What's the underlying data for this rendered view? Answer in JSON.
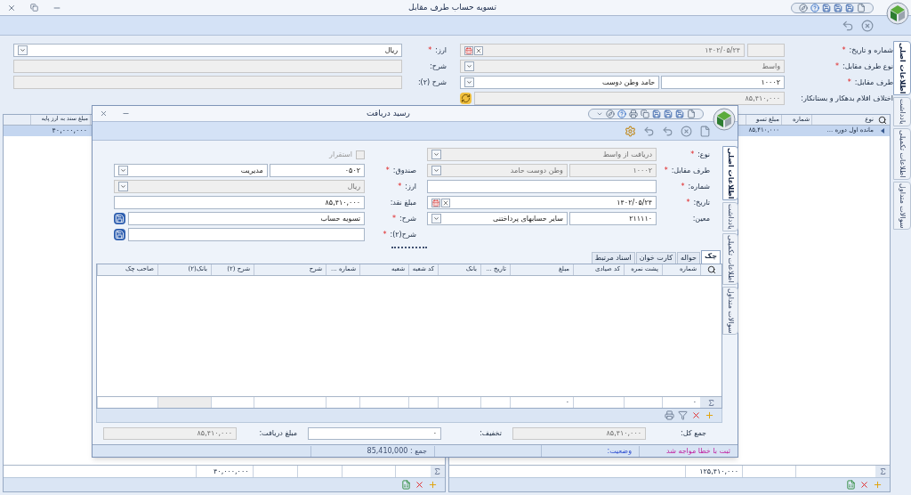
{
  "window": {
    "title": "تسویه حساب طرف مقابل"
  },
  "side_tabs": [
    {
      "label": "اطلاعات اصلی",
      "selected": true
    },
    {
      "label": "یادداشت",
      "selected": false
    },
    {
      "label": "اطلاعات تکمیلی",
      "selected": false
    },
    {
      "label": "سوالات متداول",
      "selected": false
    }
  ],
  "form": {
    "right": [
      {
        "kind": "number_date",
        "label": "شماره و تاریخ:",
        "required_mark": "*",
        "disabled": true,
        "value": "۱۴۰۲/۰۵/۲۴"
      },
      {
        "kind": "select",
        "label": "نوع طرف مقابل:",
        "required_mark": "*",
        "disabled": true,
        "value": "واسط"
      },
      {
        "kind": "code_select",
        "label": "طرف مقابل:",
        "required_mark": "*",
        "disabled": false,
        "code": "۱۰۰۰۲",
        "value": "حامد وطن دوست"
      },
      {
        "kind": "amount",
        "label": "اختلاف اقلام بدهکار و بستانکار:",
        "disabled": true,
        "value": "۸۵,۴۱۰,۰۰۰"
      }
    ],
    "left": [
      {
        "kind": "select",
        "label": "ارز:",
        "required_mark": "*",
        "disabled": false,
        "value": "ریال"
      },
      {
        "kind": "text",
        "label": "شرح:",
        "disabled": true
      },
      {
        "kind": "text",
        "label": "شرح (۲):",
        "disabled": true
      }
    ]
  },
  "grids": {
    "left": {
      "columns": [
        {
          "label": "مبلغ سند به ارز پایه"
        }
      ],
      "rows": [
        {
          "selected": true,
          "cells": [
            "۴۰,۰۰۰,۰۰۰"
          ]
        }
      ],
      "sum": "۴۰,۰۰۰,۰۰۰"
    },
    "right": {
      "columns": [
        {
          "label": "نوع"
        },
        {
          "label": "شماره"
        },
        {
          "label": "مبلغ تسو"
        }
      ],
      "rows": [
        {
          "selected": true,
          "cells": [
            "مانده اول دوره ...",
            null,
            "۸۵,۴۱۰,۰۰۰"
          ]
        }
      ],
      "sum": "۱۲۵,۴۱۰,۰۰۰"
    }
  },
  "dialog": {
    "title": "رسید دریافت",
    "right": [
      {
        "kind": "select",
        "label": "نوع:",
        "required_mark": "*",
        "disabled": true,
        "value": "دریافت از واسط"
      },
      {
        "kind": "code_select",
        "label": "طرف مقابل:",
        "required_mark": "*",
        "disabled": true,
        "code": "۱۰۰۰۲",
        "value": "وطن دوست حامد"
      },
      {
        "kind": "text",
        "label": "شماره:",
        "required_mark": "*",
        "disabled": false
      },
      {
        "kind": "date",
        "label": "تاریخ:",
        "required_mark": "*",
        "disabled": false,
        "value": "۱۴۰۲/۰۵/۲۴"
      },
      {
        "kind": "code_select",
        "label": "معین:",
        "disabled": false,
        "code": "۲۱۱۱۱۰",
        "value": "سایر حسابهای پرداختنی"
      }
    ],
    "left": [
      {
        "kind": "checkbox",
        "label": "استقرار",
        "checked": false,
        "disabled": true
      },
      {
        "kind": "code_select",
        "label": "صندوق:",
        "required_mark": "*",
        "disabled": false,
        "code": "۰۵۰۲",
        "value": "مدیریت"
      },
      {
        "kind": "select",
        "label": "ارز:",
        "required_mark": "*",
        "disabled": true,
        "value": "ریال"
      },
      {
        "kind": "text",
        "label": "مبلغ نقد:",
        "disabled": false,
        "value": "۸۵,۴۱۰,۰۰۰"
      },
      {
        "kind": "memo",
        "label": "شرح:",
        "required_mark": "*",
        "disabled": false,
        "value": "تسویه حساب"
      },
      {
        "kind": "memo",
        "label": "شرح(۲):",
        "required_mark": "*",
        "disabled": false
      }
    ],
    "tabs": [
      {
        "label": "چک",
        "selected": true
      },
      {
        "label": "حواله",
        "selected": false
      },
      {
        "label": "کارت خوان",
        "selected": false
      },
      {
        "label": "اسناد مرتبط",
        "selected": false
      }
    ],
    "grid": {
      "columns": [
        {
          "label": "شماره",
          "sum": "۰"
        },
        {
          "label": "پشت نمره"
        },
        {
          "label": "کد صیادی"
        },
        {
          "label": "مبلغ",
          "sum": "۰"
        },
        {
          "label": "تاریخ ..."
        },
        {
          "label": "بانک"
        },
        {
          "label": "کد شعبه"
        },
        {
          "label": "شعبه"
        },
        {
          "label": "شماره ..."
        },
        {
          "label": "شرح"
        },
        {
          "label": "شرح (۲)"
        },
        {
          "label": "بانک(۲)",
          "sum_disabled": true
        },
        {
          "label": "صاحب چک"
        }
      ]
    },
    "totals": [
      {
        "label": "جمع کل:",
        "value": "۸۵,۴۱۰,۰۰۰",
        "disabled": true
      },
      {
        "label": "تخفیف:",
        "value": "۰",
        "disabled": false
      },
      {
        "label": "مبلغ دریافت:",
        "value": "۸۵,۴۱۰,۰۰۰",
        "disabled": true
      }
    ],
    "status_bar": {
      "message": "ثبت با خطا مواجه شد",
      "status_label": "وضعیت:",
      "sum": "جمع : 85,410,000"
    },
    "side_tabs": [
      {
        "label": "اطلاعات اصلی",
        "selected": true
      },
      {
        "label": "یادداشت",
        "selected": false
      },
      {
        "label": "اطلاعات تکمیلی",
        "selected": false
      },
      {
        "label": "سوالات متداول",
        "selected": false
      }
    ]
  }
}
